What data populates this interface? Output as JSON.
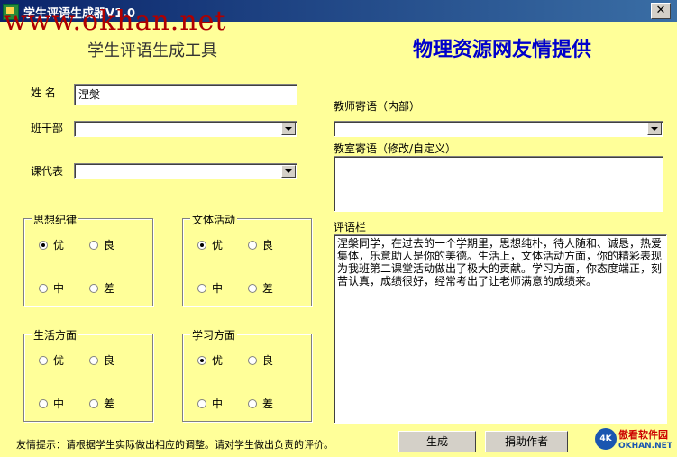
{
  "window": {
    "title": "学生评语生成器V1.0",
    "close": "✕"
  },
  "watermark": "www.okhan.net",
  "app_title": "学生评语生成工具",
  "banner": "物理资源网友情提供",
  "fields": {
    "name_label": "姓  名",
    "name_value": "涅槃",
    "class_cadre_label": "班干部",
    "class_cadre_value": "",
    "course_rep_label": "课代表",
    "course_rep_value": "",
    "teacher_msg_label": "教师寄语（内部）",
    "teacher_msg_value": "",
    "classroom_msg_label": "教室寄语（修改/自定义）",
    "classroom_msg_value": "",
    "comment_label": "评语栏",
    "comment_value": "涅槃同学，在过去的一个学期里，思想纯朴，待人随和、诚恳，热爱集体，乐意助人是你的美德。生活上，文体活动方面，你的精彩表现为我班第二课堂活动做出了极大的贡献。学习方面，你态度端正，刻苦认真，成绩很好，经常考出了让老师满意的成绩来。"
  },
  "groups": [
    {
      "legend": "思想纪律",
      "options": [
        "优",
        "良",
        "中",
        "差"
      ],
      "selected": "优"
    },
    {
      "legend": "文体活动",
      "options": [
        "优",
        "良",
        "中",
        "差"
      ],
      "selected": "优"
    },
    {
      "legend": "生活方面",
      "options": [
        "优",
        "良",
        "中",
        "差"
      ],
      "selected": ""
    },
    {
      "legend": "学习方面",
      "options": [
        "优",
        "良",
        "中",
        "差"
      ],
      "selected": "优"
    }
  ],
  "tip": "友情提示：请根据学生实际做出相应的调整。请对学生做出负责的评价。",
  "buttons": {
    "generate": "生成",
    "donate": "捐助作者"
  },
  "logo": {
    "badge": "4K",
    "line1": "傲看软件园",
    "line2": "OKHAN.NET"
  }
}
